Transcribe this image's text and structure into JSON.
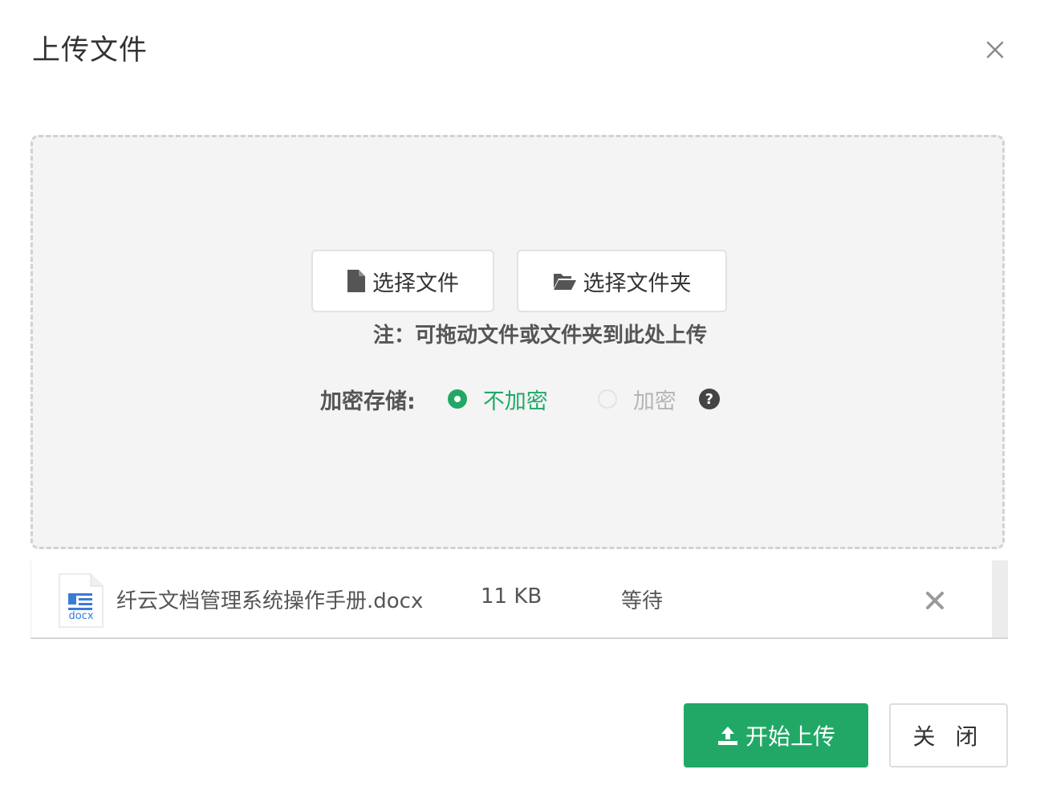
{
  "dialog": {
    "title": "上传文件"
  },
  "dropzone": {
    "select_file_label": "选择文件",
    "select_folder_label": "选择文件夹",
    "hint": "注：可拖动文件或文件夹到此处上传",
    "encryption": {
      "label": "加密存储:",
      "options": [
        {
          "label": "不加密",
          "selected": true
        },
        {
          "label": "加密",
          "selected": false
        }
      ],
      "help_glyph": "?"
    }
  },
  "file_list": [
    {
      "icon_ext": "docx",
      "name": "纤云文档管理系统操作手册.docx",
      "size": "11 KB",
      "status": "等待"
    }
  ],
  "footer": {
    "start_upload_label": "开始上传",
    "close_label": "关 闭"
  },
  "colors": {
    "accent": "#21a866",
    "dropzone_bg": "#f4f4f4",
    "dropzone_border": "#d2d2d2",
    "doc_icon_blue": "#3a7bd5"
  },
  "icons": {
    "close": "close-icon",
    "file": "file-icon",
    "folder": "folder-open-icon",
    "help": "question-circle-icon",
    "doc": "docx-file-icon",
    "remove": "remove-icon",
    "upload": "upload-icon"
  }
}
